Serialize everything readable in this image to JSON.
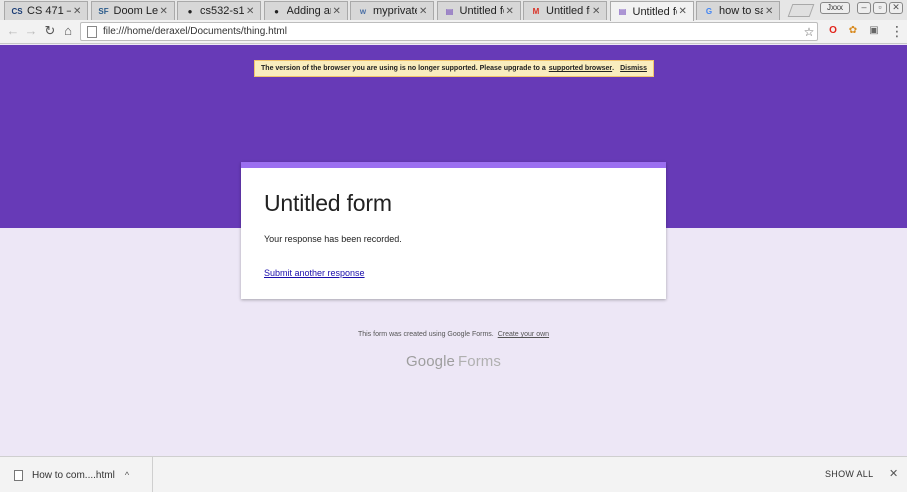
{
  "browser": {
    "tabs": [
      {
        "label": "CS 471 –",
        "favicon": "ucsd-favicon",
        "favicon_text": "CS",
        "favicon_color": "#1a3c75",
        "active": false
      },
      {
        "label": "Doom Leg",
        "favicon": "doom-favicon",
        "favicon_text": "SF",
        "favicon_color": "#2a5a8a",
        "active": false
      },
      {
        "label": "cs532-s1",
        "favicon": "github-icon",
        "favicon_text": "●",
        "favicon_color": "#222222",
        "active": false
      },
      {
        "label": "Adding an",
        "favicon": "github-icon",
        "favicon_text": "●",
        "favicon_color": "#222222",
        "active": false
      },
      {
        "label": "myprivate",
        "favicon": "site-favicon",
        "favicon_text": "w",
        "favicon_color": "#4a6fa5",
        "active": false
      },
      {
        "label": "Untitled fo",
        "favicon": "google-forms-icon",
        "favicon_text": "▤",
        "favicon_color": "#673ab7",
        "active": false
      },
      {
        "label": "Untitled fo",
        "favicon": "gmail-icon",
        "favicon_text": "M",
        "favicon_color": "#d93025",
        "active": false
      },
      {
        "label": "Untitled fo",
        "favicon": "google-forms-icon",
        "favicon_text": "▤",
        "favicon_color": "#673ab7",
        "active": true
      },
      {
        "label": "how to sa",
        "favicon": "google-icon",
        "favicon_text": "G",
        "favicon_color": "#4285f4",
        "active": false
      }
    ],
    "tab_close": "✕",
    "profile_label": "Jxxx",
    "url": "file:///home/deraxel/Documents/thing.html"
  },
  "notice": {
    "text": "The version of the browser you are using is no longer supported. Please upgrade to a",
    "link": "supported browser",
    "period": ".",
    "dismiss": "Dismiss"
  },
  "form": {
    "title": "Untitled form",
    "confirmation": "Your response has been recorded.",
    "another_link": "Submit another response"
  },
  "footer": {
    "note": "This form was created using Google Forms.",
    "create_link": "Create your own",
    "logo_google": "Google",
    "logo_forms": "Forms"
  },
  "downloads": {
    "item_name": "How to com....html",
    "show_all": "SHOW ALL"
  },
  "colors": {
    "banner": "#673ab7",
    "background": "#ede7f6",
    "card_accent": "#9b6ff0",
    "link": "#1a0dab"
  }
}
